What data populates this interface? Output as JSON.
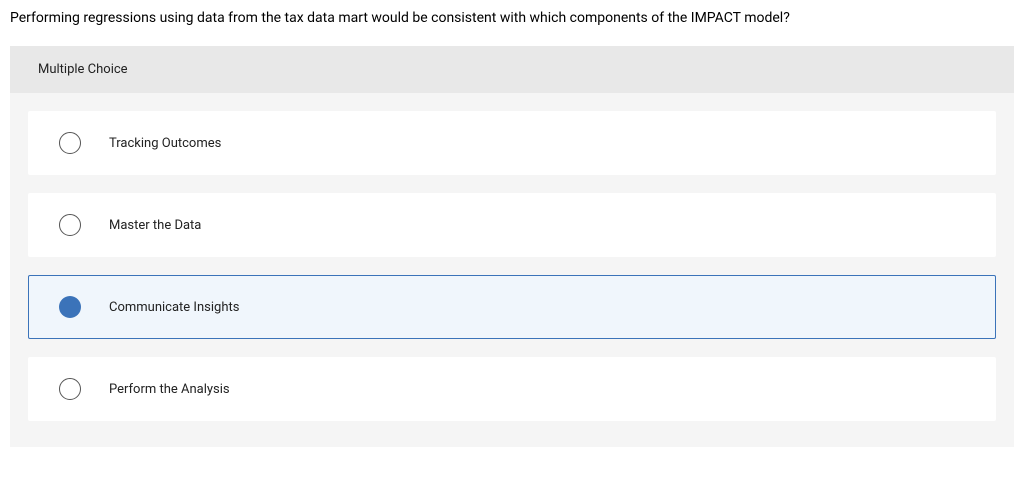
{
  "question": "Performing regressions using data from the tax data mart would be consistent with which components of the IMPACT model?",
  "question_type_label": "Multiple Choice",
  "options": [
    {
      "label": "Tracking Outcomes",
      "selected": false
    },
    {
      "label": "Master the Data",
      "selected": false
    },
    {
      "label": "Communicate Insights",
      "selected": true
    },
    {
      "label": "Perform the Analysis",
      "selected": false
    }
  ]
}
